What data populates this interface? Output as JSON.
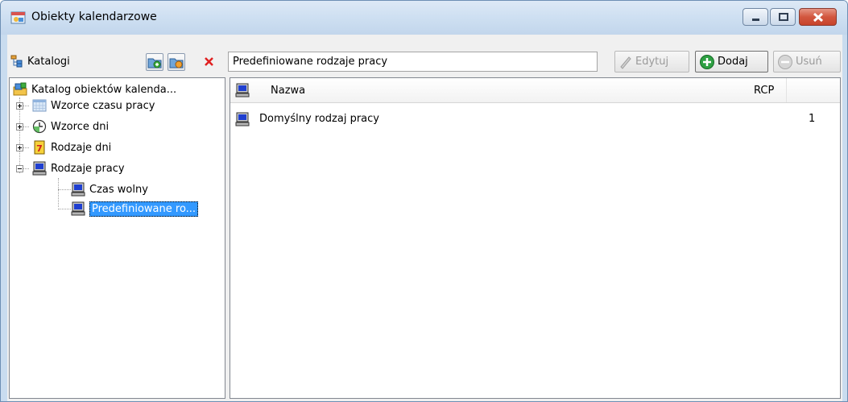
{
  "window": {
    "title": "Obiekty kalendarzowe"
  },
  "toolbar": {
    "catalogs_label": "Katalogi",
    "path_value": "Predefiniowane rodzaje pracy",
    "edit_label": "Edytuj",
    "add_label": "Dodaj",
    "delete_label": "Usuń"
  },
  "tree": {
    "root": "Katalog obiektów kalenda...",
    "items": [
      {
        "label": "Wzorce czasu pracy",
        "icon": "calendar-grid-icon"
      },
      {
        "label": "Wzorce dni",
        "icon": "clock-icon"
      },
      {
        "label": "Rodzaje dni",
        "icon": "calendar-day-icon"
      },
      {
        "label": "Rodzaje pracy",
        "icon": "computer-icon"
      }
    ],
    "children": [
      {
        "label": "Czas wolny",
        "icon": "computer-icon"
      },
      {
        "label": "Predefiniowane ro...",
        "icon": "computer-icon",
        "selected": true
      }
    ]
  },
  "list": {
    "columns": [
      "Nazwa",
      "RCP"
    ],
    "rows": [
      {
        "name": "Domyślny rodzaj pracy",
        "rcp": "1"
      }
    ]
  },
  "colors": {
    "selection": "#3399ff",
    "close_button": "#c7432a",
    "add_green": "#2ea043"
  }
}
